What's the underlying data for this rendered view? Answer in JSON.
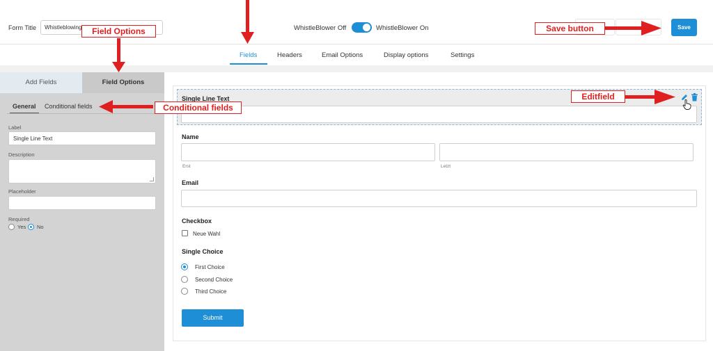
{
  "header": {
    "form_title_label": "Form Title",
    "form_title_value": "Whistleblowing",
    "toggle_off_label": "WhistleBlower Off",
    "toggle_on_label": "WhistleBlower On",
    "toggle_state": "on",
    "save_label": "Save"
  },
  "nav": {
    "tabs": [
      {
        "label": "Fields",
        "active": true
      },
      {
        "label": "Headers"
      },
      {
        "label": "Email Options"
      },
      {
        "label": "Display options"
      },
      {
        "label": "Settings"
      }
    ]
  },
  "left_panel": {
    "tabs": [
      {
        "label": "Add Fields"
      },
      {
        "label": "Field Options",
        "active": true
      }
    ],
    "subtabs": [
      {
        "label": "General",
        "active": true
      },
      {
        "label": "Conditional fields"
      }
    ],
    "label_caption": "Label",
    "label_value": "Single Line Text",
    "description_caption": "Description",
    "placeholder_caption": "Placeholder",
    "required_caption": "Required",
    "required_yes": "Yes",
    "required_no": "No",
    "required_selected": "No"
  },
  "form": {
    "single_line": {
      "title": "Single Line Text"
    },
    "name": {
      "title": "Name",
      "first_hint": "Erst",
      "last_hint": "Letzt"
    },
    "email": {
      "title": "Email"
    },
    "checkbox": {
      "title": "Checkbox",
      "option": "Neue Wahl"
    },
    "single_choice": {
      "title": "Single Choice",
      "options": [
        "First Choice",
        "Second Choice",
        "Third Choice"
      ],
      "selected": "First Choice"
    },
    "submit_label": "Submit"
  },
  "icons": {
    "edit": "pencil-icon",
    "delete": "trash-icon",
    "cursor": "hand-pointer-icon"
  },
  "annotations": {
    "field_options": "Field Options",
    "conditional_fields": "Conditional fields",
    "save_button": "Save button",
    "editfield": "Editfield"
  },
  "colors": {
    "accent": "#1e8fd6",
    "annotation": "#e02020",
    "panel_bg": "#d3d3d3"
  }
}
